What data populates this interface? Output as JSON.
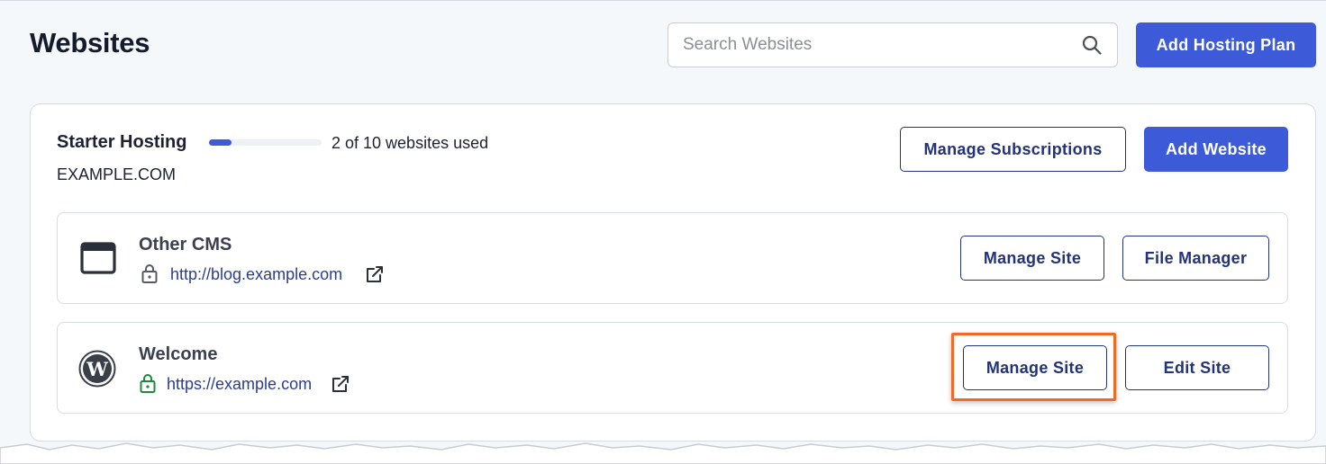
{
  "header": {
    "title": "Websites",
    "search_placeholder": "Search Websites",
    "search_value": "",
    "add_hosting_plan_label": "Add Hosting Plan"
  },
  "plan": {
    "name": "Starter Hosting",
    "usage_text": "2 of 10 websites used",
    "usage_fraction": 0.2,
    "domain": "EXAMPLE.COM",
    "manage_subscriptions_label": "Manage Subscriptions",
    "add_website_label": "Add Website"
  },
  "sites": [
    {
      "name": "Other CMS",
      "url": "http://blog.example.com",
      "icon": "browser-window-icon",
      "secure": false,
      "buttons": [
        "Manage Site",
        "File Manager"
      ]
    },
    {
      "name": "Welcome",
      "url": "https://example.com",
      "icon": "wordpress-icon",
      "secure": true,
      "buttons": [
        "Manage Site",
        "Edit Site"
      ]
    }
  ],
  "colors": {
    "primary": "#3d5bd9",
    "outline_text": "#23337a",
    "secure_lock": "#1e8a3a",
    "highlight": "#f06a26",
    "page_background": "#f5f8fb"
  }
}
